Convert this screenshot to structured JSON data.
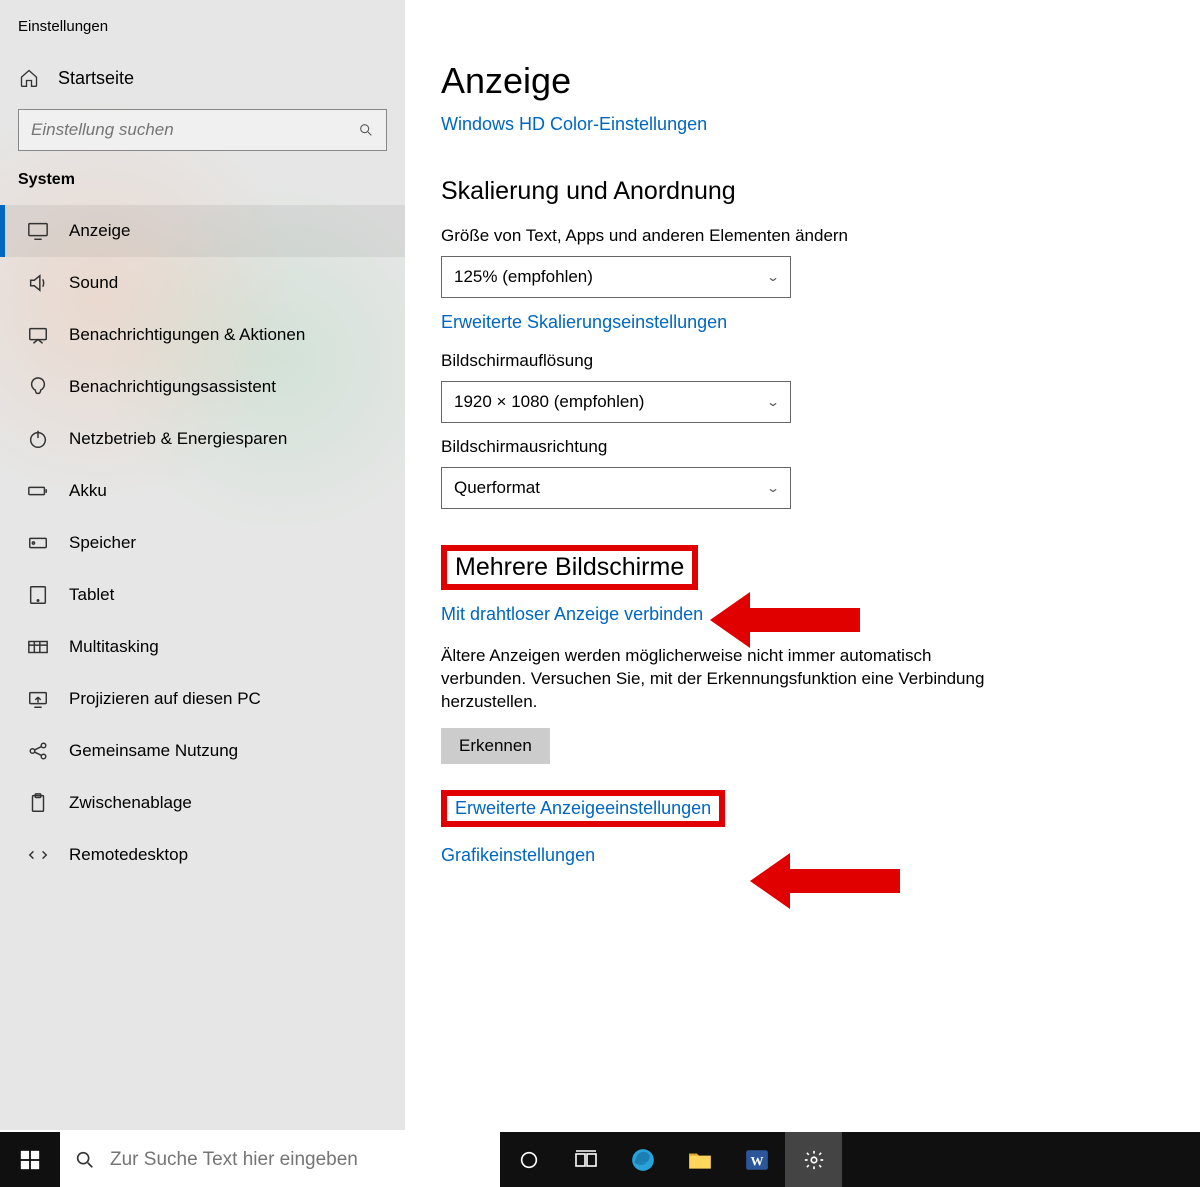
{
  "window_title": "Einstellungen",
  "sidebar": {
    "home": "Startseite",
    "search_placeholder": "Einstellung suchen",
    "section": "System",
    "items": [
      {
        "icon": "display",
        "label": "Anzeige",
        "active": true
      },
      {
        "icon": "sound",
        "label": "Sound"
      },
      {
        "icon": "notifications",
        "label": "Benachrichtigungen & Aktionen"
      },
      {
        "icon": "focus",
        "label": "Benachrichtigungsassistent"
      },
      {
        "icon": "power",
        "label": "Netzbetrieb & Energiesparen"
      },
      {
        "icon": "battery",
        "label": "Akku"
      },
      {
        "icon": "storage",
        "label": "Speicher"
      },
      {
        "icon": "tablet",
        "label": "Tablet"
      },
      {
        "icon": "multitask",
        "label": "Multitasking"
      },
      {
        "icon": "project",
        "label": "Projizieren auf diesen PC"
      },
      {
        "icon": "share",
        "label": "Gemeinsame Nutzung"
      },
      {
        "icon": "clipboard",
        "label": "Zwischenablage"
      },
      {
        "icon": "remote",
        "label": "Remotedesktop"
      }
    ]
  },
  "main": {
    "title": "Anzeige",
    "hdcolor_link": "Windows HD Color-Einstellungen",
    "scaling_h2": "Skalierung und Anordnung",
    "textsize_label": "Größe von Text, Apps und anderen Elementen ändern",
    "textsize_value": "125% (empfohlen)",
    "adv_scaling_link": "Erweiterte Skalierungseinstellungen",
    "resolution_label": "Bildschirmauflösung",
    "resolution_value": "1920 × 1080 (empfohlen)",
    "orientation_label": "Bildschirmausrichtung",
    "orientation_value": "Querformat",
    "multi_h2": "Mehrere Bildschirme",
    "wireless_link": "Mit drahtloser Anzeige verbinden",
    "older_text": "Ältere Anzeigen werden möglicherweise nicht immer automatisch verbunden. Versuchen Sie, mit der Erkennungsfunktion eine Verbindung herzustellen.",
    "detect_btn": "Erkennen",
    "adv_display_link": "Erweiterte Anzeigeeinstellungen",
    "graphics_link": "Grafikeinstellungen"
  },
  "taskbar": {
    "search_placeholder": "Zur Suche Text hier eingeben"
  }
}
